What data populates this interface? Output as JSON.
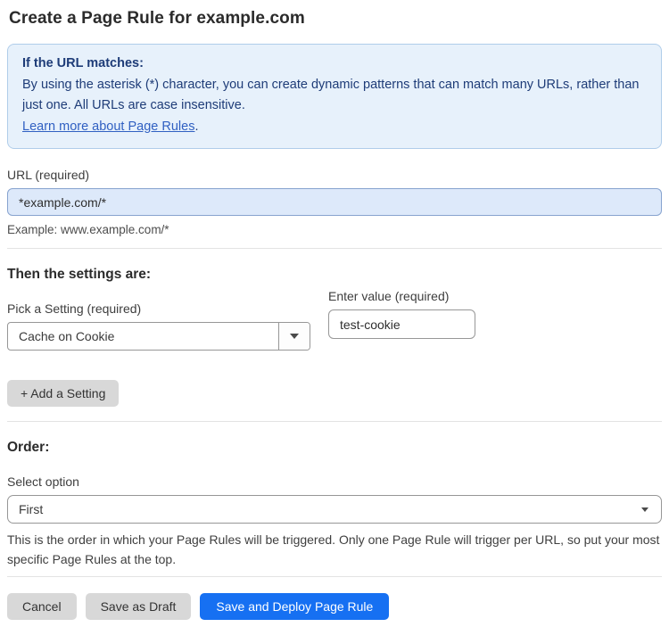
{
  "page": {
    "title": "Create a Page Rule for example.com"
  },
  "info_box": {
    "heading": "If the URL matches:",
    "body": "By using the asterisk (*) character, you can create dynamic patterns that can match many URLs, rather than just one. All URLs are case insensitive.",
    "link_label": "Learn more about Page Rules",
    "link_suffix": "."
  },
  "url_field": {
    "label": "URL (required)",
    "value": "*example.com/*",
    "example": "Example: www.example.com/*"
  },
  "settings": {
    "heading": "Then the settings are:",
    "setting_label": "Pick a Setting (required)",
    "setting_selected": "Cache on Cookie",
    "value_label": "Enter value (required)",
    "value": "test-cookie",
    "add_button_label": "+ Add a Setting"
  },
  "order": {
    "heading": "Order:",
    "label": "Select option",
    "selected": "First",
    "help": "This is the order in which your Page Rules will be triggered. Only one Page Rule will trigger per URL, so put your most specific Page Rules at the top."
  },
  "footer": {
    "cancel_label": "Cancel",
    "save_draft_label": "Save as Draft",
    "save_deploy_label": "Save and Deploy Page Rule"
  },
  "colors": {
    "accent_blue": "#1670f2",
    "info_bg": "#e7f1fb",
    "info_border": "#b0cdea",
    "info_text": "#1e3c78",
    "link_blue": "#3060c2",
    "url_input_bg": "#dde9fa",
    "button_gray": "#d8d8d8"
  }
}
